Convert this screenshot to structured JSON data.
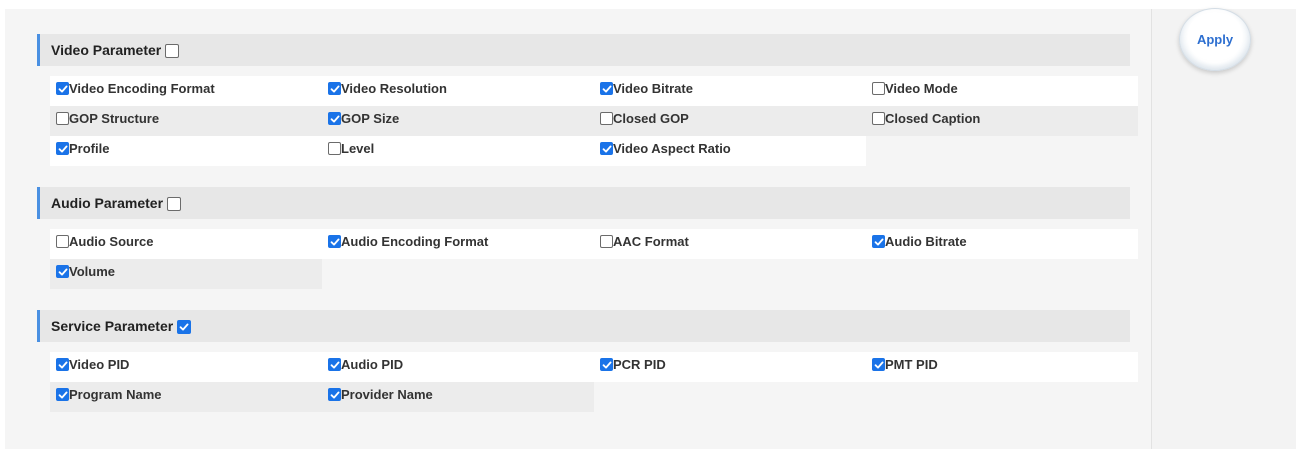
{
  "apply_label": "Apply",
  "sections": {
    "video": {
      "title": "Video Parameter",
      "checked": false,
      "items": [
        {
          "label": "Video Encoding Format",
          "checked": true
        },
        {
          "label": "Video Resolution",
          "checked": true
        },
        {
          "label": "Video Bitrate",
          "checked": true
        },
        {
          "label": "Video Mode",
          "checked": false
        },
        {
          "label": "GOP Structure",
          "checked": false
        },
        {
          "label": "GOP Size",
          "checked": true
        },
        {
          "label": "Closed GOP",
          "checked": false
        },
        {
          "label": "Closed Caption",
          "checked": false
        },
        {
          "label": "Profile",
          "checked": true
        },
        {
          "label": "Level",
          "checked": false
        },
        {
          "label": "Video Aspect Ratio",
          "checked": true
        }
      ]
    },
    "audio": {
      "title": "Audio Parameter",
      "checked": false,
      "items": [
        {
          "label": "Audio Source",
          "checked": false
        },
        {
          "label": "Audio Encoding Format",
          "checked": true
        },
        {
          "label": "AAC Format",
          "checked": false
        },
        {
          "label": "Audio Bitrate",
          "checked": true
        },
        {
          "label": "Volume",
          "checked": true
        }
      ]
    },
    "service": {
      "title": "Service Parameter",
      "checked": true,
      "items": [
        {
          "label": "Video PID",
          "checked": true
        },
        {
          "label": "Audio PID",
          "checked": true
        },
        {
          "label": "PCR PID",
          "checked": true
        },
        {
          "label": "PMT PID",
          "checked": true
        },
        {
          "label": "Program Name",
          "checked": true
        },
        {
          "label": "Provider Name",
          "checked": true
        }
      ]
    }
  },
  "colors": {
    "accent": "#1a73e8",
    "header_bar": "#4a90e2",
    "apply_text": "#2d6fd0"
  }
}
